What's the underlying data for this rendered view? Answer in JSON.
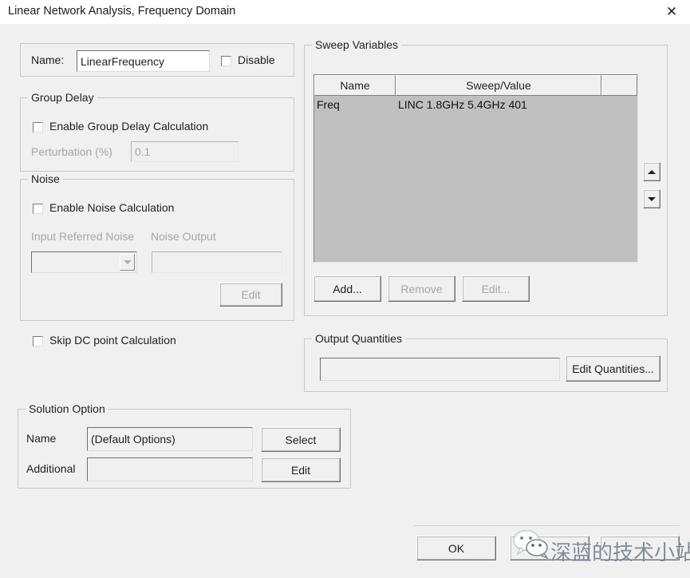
{
  "window": {
    "title": "Linear Network Analysis, Frequency Domain",
    "close_icon": "close-icon"
  },
  "name_row": {
    "label": "Name:",
    "value": "LinearFrequency",
    "disable_label": "Disable",
    "disable_checked": false
  },
  "group_delay": {
    "title": "Group Delay",
    "enable_label": "Enable Group Delay Calculation",
    "enable_checked": false,
    "perturbation_label": "Perturbation (%)",
    "perturbation_value": "0.1"
  },
  "noise": {
    "title": "Noise",
    "enable_label": "Enable Noise Calculation",
    "enable_checked": false,
    "input_referred_label": "Input Referred Noise",
    "input_referred_value": "",
    "noise_output_label": "Noise Output",
    "noise_output_value": "",
    "edit_label": "Edit",
    "dropdown_icon": "chevron-down-icon"
  },
  "skip_dc": {
    "label": "Skip DC point Calculation",
    "checked": false
  },
  "sweep": {
    "title": "Sweep Variables",
    "columns": [
      "Name",
      "Sweep/Value",
      ""
    ],
    "rows": [
      {
        "name": "Freq",
        "value": "LINC 1.8GHz 5.4GHz 401"
      }
    ],
    "scroll_up_icon": "triangle-up-icon",
    "scroll_down_icon": "triangle-down-icon",
    "add_label": "Add...",
    "remove_label": "Remove",
    "edit_label": "Edit..."
  },
  "output_quantities": {
    "title": "Output Quantities",
    "value": "",
    "edit_label": "Edit Quantities..."
  },
  "solution_option": {
    "title": "Solution Option",
    "name_label": "Name",
    "name_value": "(Default Options)",
    "select_label": "Select",
    "additional_label": "Additional",
    "additional_value": "",
    "edit_label": "Edit"
  },
  "footer": {
    "ok_label": "OK",
    "second_label": "",
    "third_label": ""
  },
  "watermark": {
    "text": "深蓝的技术小站",
    "logo_icon": "wechat-logo-icon"
  },
  "colors": {
    "dialog_bg": "#f0f0f0",
    "listbox_bg": "#c0c0c0",
    "text": "#1f1f1f",
    "disabled_text": "#a6a6a6",
    "border": "#c8c8c8"
  }
}
